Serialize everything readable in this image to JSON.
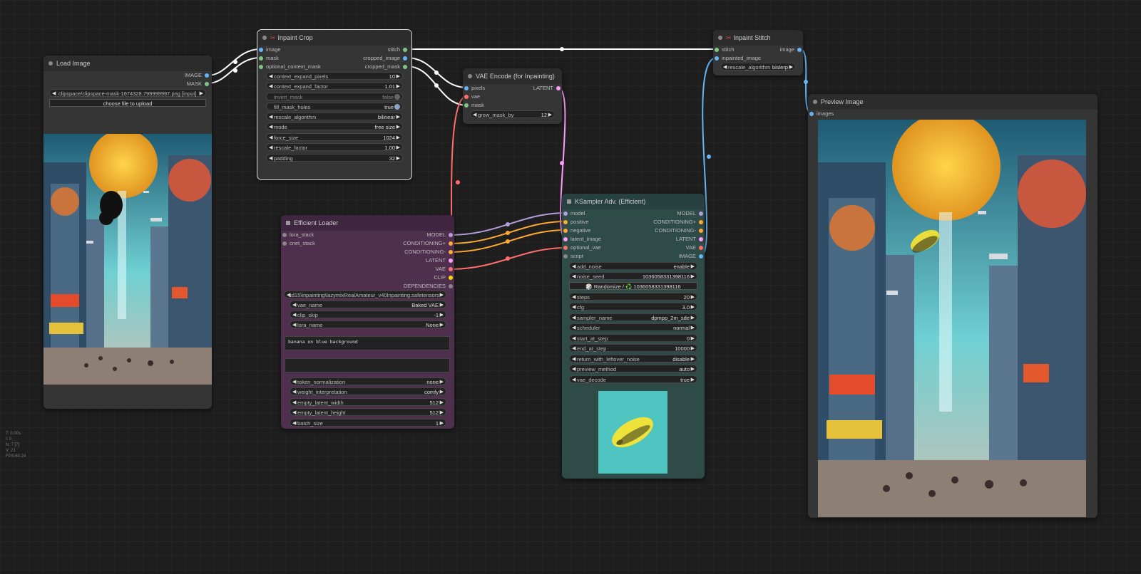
{
  "nodes": {
    "load_image": {
      "title": "Load Image",
      "outputs": [
        "IMAGE",
        "MASK"
      ],
      "image_file": "clipspace/clipspace-mask-1674328.799999997.png [input]",
      "upload_label": "choose file to upload"
    },
    "inpaint_crop": {
      "title": "Inpaint Crop",
      "inputs": [
        "image",
        "mask",
        "optional_context_mask"
      ],
      "outputs": [
        "stitch",
        "cropped_image",
        "cropped_mask"
      ],
      "widgets": [
        {
          "label": "context_expand_pixels",
          "value": "10"
        },
        {
          "label": "context_expand_factor",
          "value": "1.01"
        },
        {
          "label": "invert_mask",
          "value": "false"
        },
        {
          "label": "fill_mask_holes",
          "value": "true"
        },
        {
          "label": "rescale_algorithm",
          "value": "bilinear"
        },
        {
          "label": "mode",
          "value": "free size"
        },
        {
          "label": "force_size",
          "value": "1024"
        },
        {
          "label": "rescale_factor",
          "value": "1.00"
        },
        {
          "label": "padding",
          "value": "32"
        }
      ]
    },
    "vae_encode": {
      "title": "VAE Encode (for Inpainting)",
      "inputs": [
        "pixels",
        "vae",
        "mask"
      ],
      "outputs": [
        "LATENT"
      ],
      "widgets": [
        {
          "label": "grow_mask_by",
          "value": "12"
        }
      ]
    },
    "inpaint_stitch": {
      "title": "Inpaint Stitch",
      "inputs": [
        "stitch",
        "inpainted_image"
      ],
      "outputs": [
        "image"
      ],
      "widgets": [
        {
          "label": "rescale_algorithm",
          "value": "bislerp"
        }
      ]
    },
    "preview_image": {
      "title": "Preview Image",
      "inputs": [
        "images"
      ]
    },
    "efficient_loader": {
      "title": "Efficient Loader",
      "inputs": [
        "lora_stack",
        "cnet_stack"
      ],
      "outputs": [
        "MODEL",
        "CONDITIONING+",
        "CONDITIONING-",
        "LATENT",
        "VAE",
        "CLIP",
        "DEPENDENCIES"
      ],
      "ckpt_label": "sd15\\inpainting\\lazymixRealAmateur_v40Inpainting.safetensors",
      "widgets_top": [
        {
          "label": "vae_name",
          "value": "Baked VAE"
        },
        {
          "label": "clip_skip",
          "value": "-1"
        },
        {
          "label": "lora_name",
          "value": "None"
        }
      ],
      "positive_prompt": "banana on blue background",
      "negative_prompt": "",
      "widgets_bottom": [
        {
          "label": "token_normalization",
          "value": "none"
        },
        {
          "label": "weight_interpretation",
          "value": "comfy"
        },
        {
          "label": "empty_latent_width",
          "value": "512"
        },
        {
          "label": "empty_latent_height",
          "value": "512"
        },
        {
          "label": "batch_size",
          "value": "1"
        }
      ]
    },
    "ksampler": {
      "title": "KSampler Adv. (Efficient)",
      "inputs": [
        "model",
        "positive",
        "negative",
        "latent_image",
        "optional_vae",
        "script"
      ],
      "outputs": [
        "MODEL",
        "CONDITIONING+",
        "CONDITIONING-",
        "LATENT",
        "VAE",
        "IMAGE"
      ],
      "widgets_a": [
        {
          "label": "add_noise",
          "value": "enable"
        },
        {
          "label": "noise_seed",
          "value": "1036058331398116"
        }
      ],
      "randomize_label": "🎲 Randomize / ♻️ 1036058331398116",
      "widgets_b": [
        {
          "label": "steps",
          "value": "20"
        },
        {
          "label": "cfg",
          "value": "3.0"
        },
        {
          "label": "sampler_name",
          "value": "dpmpp_2m_sde"
        },
        {
          "label": "scheduler",
          "value": "normal"
        },
        {
          "label": "start_at_step",
          "value": "0"
        },
        {
          "label": "end_at_step",
          "value": "10000"
        },
        {
          "label": "return_with_leftover_noise",
          "value": "disable"
        },
        {
          "label": "preview_method",
          "value": "auto"
        },
        {
          "label": "vae_decode",
          "value": "true"
        }
      ]
    }
  },
  "stats": [
    "T: 0.00s",
    "I: 0",
    "N: 7 [7]",
    "V: 21",
    "FPS:60.24"
  ],
  "colors": {
    "image": "#64b5f6",
    "mask": "#81c784",
    "vae": "#ff6e6e",
    "latent": "#ff9cf9",
    "model": "#b39ddb",
    "conditioning": "#ffa931",
    "clip": "#ffd500",
    "stitch": "#ffffff",
    "loader_body": "#4e2f4d",
    "loader_title": "#3f2540",
    "ksampler_body": "#2f4b47",
    "ksampler_title": "#264140"
  }
}
